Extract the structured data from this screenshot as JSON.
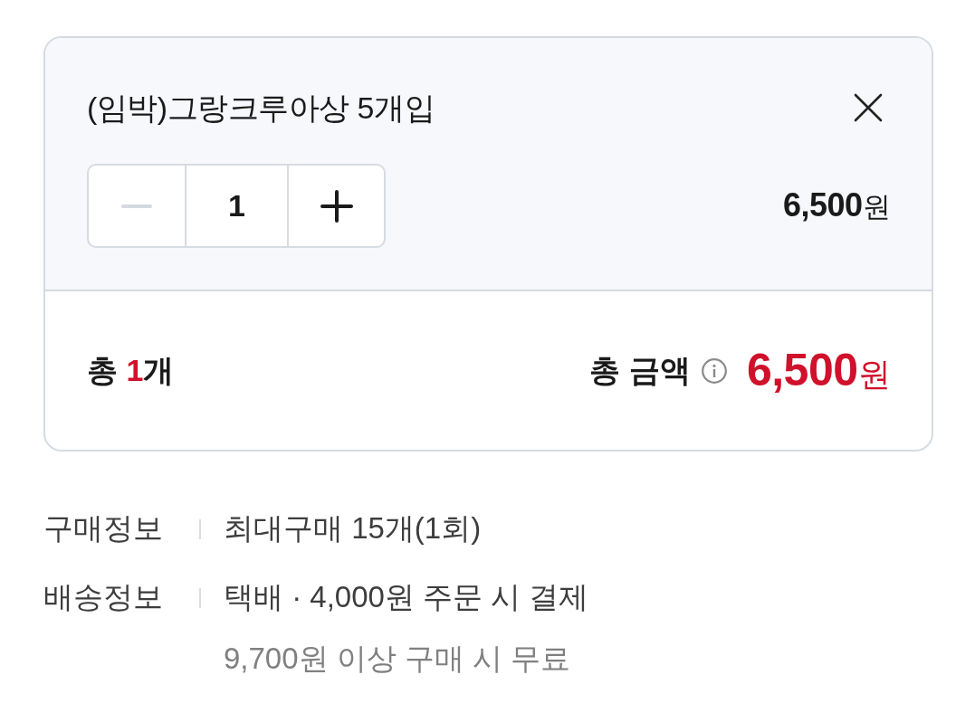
{
  "item": {
    "title": "(임박)그랑크루아상 5개입",
    "quantity": {
      "value": "1",
      "decrease": {
        "disabled": true
      },
      "increase": {
        "disabled": false
      }
    },
    "price": {
      "amount": "6,500",
      "unit": "원"
    }
  },
  "summary": {
    "count_prefix": "총",
    "count": "1",
    "count_unit": "개",
    "total_label": "총 금액",
    "total_amount": "6,500",
    "total_unit": "원"
  },
  "info": [
    {
      "label": "구매정보",
      "lines": [
        {
          "text": "최대구매 15개(1회)",
          "kind": "main"
        }
      ]
    },
    {
      "label": "배송정보",
      "lines": [
        {
          "text": "택배 · 4,000원 주문 시 결제",
          "kind": "main"
        },
        {
          "text": "9,700원 이상 구매 시 무료",
          "kind": "note"
        }
      ]
    }
  ]
}
